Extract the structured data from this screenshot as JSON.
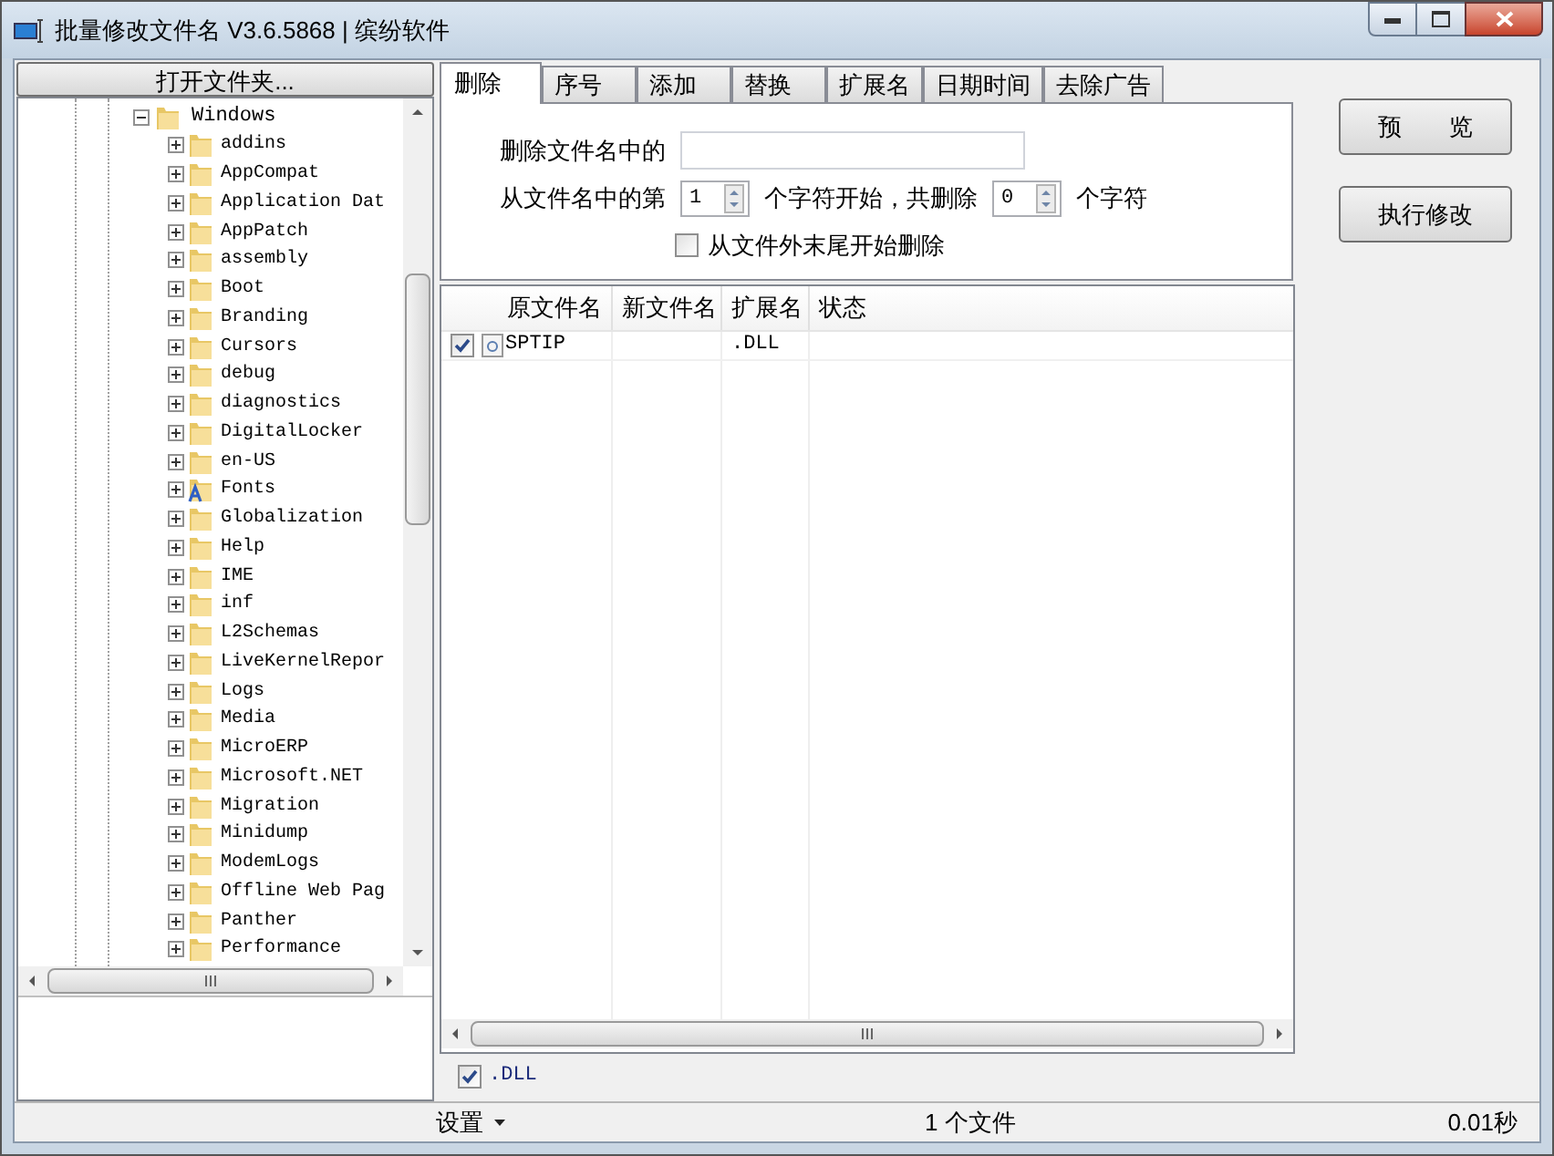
{
  "window": {
    "title": "批量修改文件名 V3.6.5868 | 缤纷软件"
  },
  "open_folder_button": "打开文件夹...",
  "tree": {
    "label": "Windows",
    "expanded": true,
    "children": [
      {
        "label": "addins",
        "kind": "folder"
      },
      {
        "label": "AppCompat",
        "kind": "folder"
      },
      {
        "label": "Application Dat",
        "kind": "folder"
      },
      {
        "label": "AppPatch",
        "kind": "folder"
      },
      {
        "label": "assembly",
        "kind": "folder"
      },
      {
        "label": "Boot",
        "kind": "folder"
      },
      {
        "label": "Branding",
        "kind": "folder"
      },
      {
        "label": "Cursors",
        "kind": "folder"
      },
      {
        "label": "debug",
        "kind": "folder"
      },
      {
        "label": "diagnostics",
        "kind": "folder"
      },
      {
        "label": "DigitalLocker",
        "kind": "folder"
      },
      {
        "label": "en-US",
        "kind": "folder"
      },
      {
        "label": "Fonts",
        "kind": "fonts"
      },
      {
        "label": "Globalization",
        "kind": "folder"
      },
      {
        "label": "Help",
        "kind": "folder"
      },
      {
        "label": "IME",
        "kind": "folder"
      },
      {
        "label": "inf",
        "kind": "folder"
      },
      {
        "label": "L2Schemas",
        "kind": "folder"
      },
      {
        "label": "LiveKernelRepor",
        "kind": "folder"
      },
      {
        "label": "Logs",
        "kind": "folder"
      },
      {
        "label": "Media",
        "kind": "folder"
      },
      {
        "label": "MicroERP",
        "kind": "folder"
      },
      {
        "label": "Microsoft.NET",
        "kind": "folder"
      },
      {
        "label": "Migration",
        "kind": "folder"
      },
      {
        "label": "Minidump",
        "kind": "folder"
      },
      {
        "label": "ModemLogs",
        "kind": "folder"
      },
      {
        "label": "Offline Web Pag",
        "kind": "folder"
      },
      {
        "label": "Panther",
        "kind": "folder"
      },
      {
        "label": "Performance",
        "kind": "folder"
      }
    ]
  },
  "tabs": [
    {
      "label": "删除",
      "selected": true
    },
    {
      "label": "序号",
      "selected": false
    },
    {
      "label": "添加",
      "selected": false
    },
    {
      "label": "替换",
      "selected": false
    },
    {
      "label": "扩展名",
      "selected": false
    },
    {
      "label": "日期时间",
      "selected": false
    },
    {
      "label": "去除广告",
      "selected": false
    }
  ],
  "delete_panel": {
    "text_label": "删除文件名中的",
    "from_label": "从文件名中的第",
    "start": "1",
    "middle_label": "个字符开始，共删除",
    "count": "0",
    "end_label": "个字符",
    "from_end": {
      "label": "从文件外末尾开始删除",
      "checked": false
    }
  },
  "buttons": [
    "预　　览",
    "执行修改"
  ],
  "table": {
    "columns": [
      "原文件名",
      "新文件名",
      "扩展名",
      "状态"
    ],
    "rows": [
      {
        "checked": true,
        "name": "SPTIP",
        "new_name": "",
        "extension": ".DLL",
        "status": ""
      }
    ]
  },
  "filters": [
    {
      "label": ".DLL",
      "checked": true
    }
  ],
  "status_bar": {
    "settings": "设置",
    "count": "1 个文件",
    "time": "0.01秒"
  }
}
